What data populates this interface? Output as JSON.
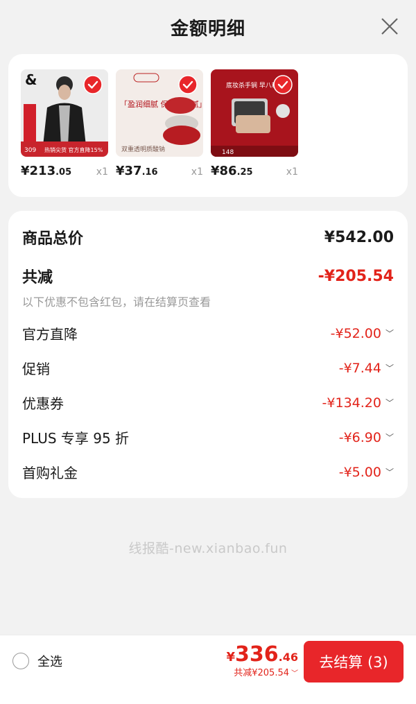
{
  "header": {
    "title": "金额明细"
  },
  "products": [
    {
      "price_int": "¥213",
      "price_dec": ".05",
      "qty": "x1",
      "img_caption": "热销尖货 官方直降15%",
      "img_badge": "309"
    },
    {
      "price_int": "¥37",
      "price_dec": ".16",
      "qty": "x1",
      "img_caption": "「盈润细腻 保湿不粘腻」",
      "img_sub": "双重透明质酸钠"
    },
    {
      "price_int": "¥86",
      "price_dec": ".25",
      "qty": "x1",
      "img_caption": "底妆杀手锏 早八秒出",
      "img_badge": "148"
    }
  ],
  "summary": {
    "total_label": "商品总价",
    "total_value": "¥542.00",
    "reduce_label": "共减",
    "reduce_value": "-¥205.54",
    "note": "以下优惠不包含红包，请在结算页查看",
    "items": [
      {
        "label": "官方直降",
        "value": "-¥52.00"
      },
      {
        "label": "促销",
        "value": "-¥7.44"
      },
      {
        "label": "优惠券",
        "value": "-¥134.20"
      },
      {
        "label": "PLUS 专享 95 折",
        "value": "-¥6.90"
      },
      {
        "label": "首购礼金",
        "value": "-¥5.00"
      }
    ]
  },
  "watermark": "线报酷-new.xianbao.fun",
  "footer": {
    "select_all": "全选",
    "currency": "¥",
    "amount_int": "336",
    "amount_dec": ".46",
    "discount": "共减¥205.54",
    "checkout": "去结算 (3)"
  },
  "colors": {
    "accent": "#e2231a",
    "checkout_bg": "#e8262a"
  }
}
